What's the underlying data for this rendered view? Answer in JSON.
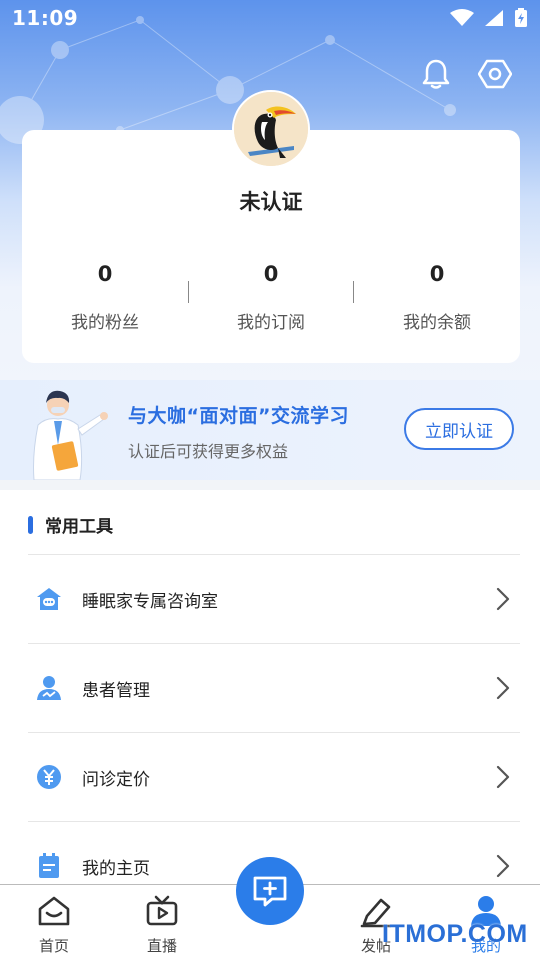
{
  "status_bar": {
    "time": "11:09"
  },
  "colors": {
    "accent": "#2b6ee0",
    "tab_active": "#2b7de9",
    "header_top": "#5d93ec"
  },
  "header": {
    "icons": [
      "bell-icon",
      "settings-icon"
    ]
  },
  "profile": {
    "avatar": "toucan-avatar",
    "status_title": "未认证",
    "stats": [
      {
        "value": "0",
        "label": "我的粉丝"
      },
      {
        "value": "0",
        "label": "我的订阅"
      },
      {
        "value": "0",
        "label": "我的余额"
      }
    ]
  },
  "promo": {
    "title": "与大咖“面对面”交流学习",
    "subtitle": "认证后可获得更多权益",
    "button_label": "立即认证"
  },
  "tools": {
    "title": "常用工具",
    "items": [
      {
        "label": "睡眠家专属咨询室",
        "icon": "consult-room-icon"
      },
      {
        "label": "患者管理",
        "icon": "patient-icon"
      },
      {
        "label": "问诊定价",
        "icon": "price-icon"
      },
      {
        "label": "我的主页",
        "icon": "homepage-icon"
      }
    ]
  },
  "tabbar": {
    "items": [
      {
        "label": "首页",
        "icon": "home-icon"
      },
      {
        "label": "直播",
        "icon": "tv-icon"
      },
      {
        "label": "",
        "icon": "post-message-icon"
      },
      {
        "label": "发帖",
        "icon": "edit-icon"
      },
      {
        "label": "我的",
        "icon": "user-icon",
        "active": true
      }
    ]
  },
  "watermark": "ITMOP.COM"
}
